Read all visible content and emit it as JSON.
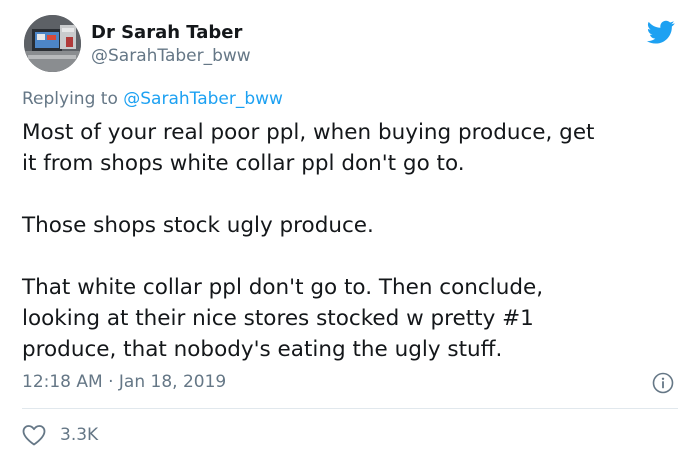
{
  "author": {
    "name": "Dr Sarah Taber",
    "handle": "@SarahTaber_bww",
    "avatar_icon": "avatar-photo"
  },
  "reply": {
    "prefix": "Replying to ",
    "mention": "@SarahTaber_bww"
  },
  "paragraphs": [
    "Most of your real poor ppl, when buying produce, get\nit from shops white collar ppl don't go to.",
    "Those shops stock ugly produce.",
    "That white collar ppl don't go to. Then conclude,\nlooking at their nice stores stocked w pretty #1\nproduce, that nobody's eating the ugly stuff."
  ],
  "meta": {
    "timestamp": "12:18 AM · Jan 18, 2019"
  },
  "engagement": {
    "likes": "3.3K"
  },
  "colors": {
    "brand": "#1da1f2",
    "text": "#14171a",
    "secondary": "#657786",
    "divider": "#e1e8ed"
  },
  "icons": [
    "twitter-bird-icon",
    "info-icon",
    "heart-icon"
  ]
}
